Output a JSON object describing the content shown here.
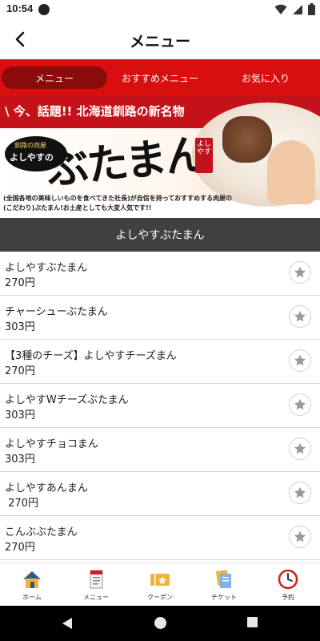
{
  "status": {
    "time": "10:54"
  },
  "header": {
    "title": "メニュー"
  },
  "tabs": [
    {
      "label": "メニュー",
      "active": true
    },
    {
      "label": "おすすめメニュー",
      "active": false
    },
    {
      "label": "お気に入り",
      "active": false
    }
  ],
  "banner": {
    "tagline": "\\ 今、話題!! 北海道釧路の新名物",
    "badge_small": "釧路の肉屋",
    "badge_name": "よしやすの",
    "title": "ぶたまん",
    "seal": "よしやす",
    "description": "(全国各地の美味しいものを食べてきた社長)が自信を持っておすすめする肉屋の(こだわり)ぶたまん!お土産としても大変人気です!!"
  },
  "section": {
    "title": "よしやすぶたまん"
  },
  "items": [
    {
      "name": "よしやすぶたまん",
      "price": "270円"
    },
    {
      "name": "チャーシューぶたまん",
      "price": "303円"
    },
    {
      "name": "【3種のチーズ】よしやすチーズまん",
      "price": "270円"
    },
    {
      "name": "よしやすWチーズぶたまん",
      "price": "303円"
    },
    {
      "name": "よしやすチョコまん",
      "price": "303円"
    },
    {
      "name": "よしやすあんまん",
      "price": " 270円"
    },
    {
      "name": "こんぶぶたまん",
      "price": "270円"
    }
  ],
  "bottom_nav": [
    {
      "label": "ホーム",
      "icon": "home-icon"
    },
    {
      "label": "メニュー",
      "icon": "menu-book-icon"
    },
    {
      "label": "クーポン",
      "icon": "coupon-icon"
    },
    {
      "label": "チケット",
      "icon": "ticket-icon"
    },
    {
      "label": "予約",
      "icon": "clock-icon"
    }
  ],
  "colors": {
    "accent": "#d90f0f",
    "tab_active": "#8b0a0a",
    "section_bg": "#404040"
  }
}
